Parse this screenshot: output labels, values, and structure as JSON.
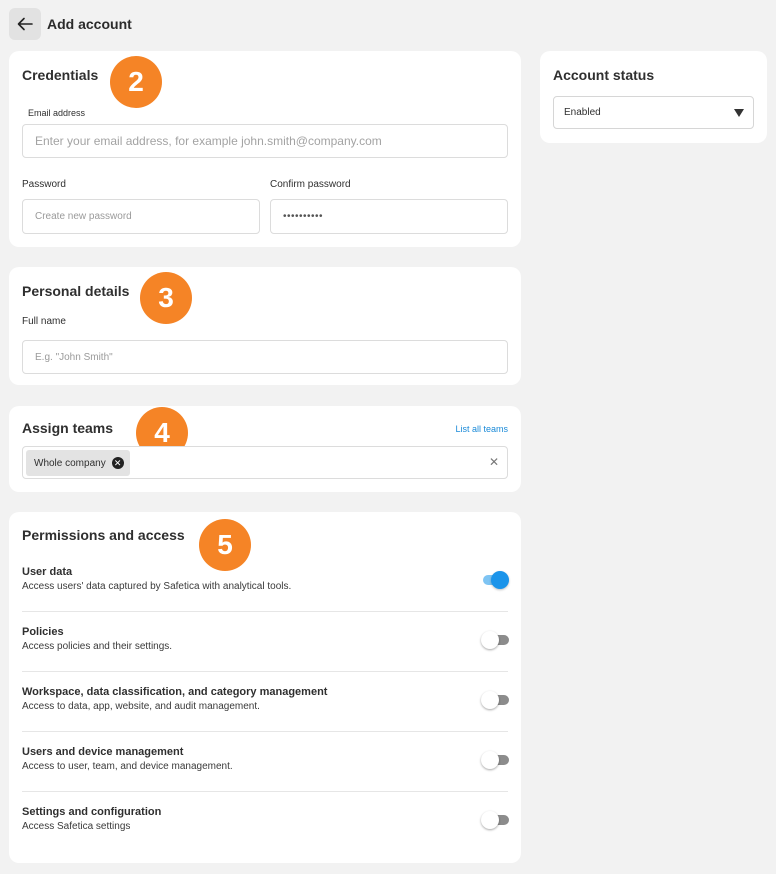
{
  "header": {
    "title": "Add account",
    "back_icon": "arrow-left-icon"
  },
  "credentials": {
    "title": "Credentials",
    "step": "2",
    "email_label": "Email address",
    "email_placeholder": "Enter your email address, for example john.smith@company.com",
    "password_label": "Password",
    "password_placeholder": "Create new password",
    "confirm_label": "Confirm password",
    "confirm_value": "••••••••••"
  },
  "personal": {
    "title": "Personal details",
    "step": "3",
    "fullname_label": "Full name",
    "fullname_placeholder": "E.g. \"John Smith\""
  },
  "teams": {
    "title": "Assign teams",
    "step": "4",
    "list_link": "List all teams",
    "chips": [
      "Whole company"
    ]
  },
  "permissions": {
    "title": "Permissions and access",
    "step": "5",
    "items": [
      {
        "title": "User data",
        "desc": "Access users' data captured by Safetica with analytical tools.",
        "enabled": true
      },
      {
        "title": "Policies",
        "desc": "Access policies and their settings.",
        "enabled": false
      },
      {
        "title": "Workspace, data classification, and category management",
        "desc": "Access to data, app, website, and audit management.",
        "enabled": false
      },
      {
        "title": "Users and device management",
        "desc": "Access to user, team, and device management.",
        "enabled": false
      },
      {
        "title": "Settings and configuration",
        "desc": "Access Safetica settings",
        "enabled": false
      }
    ]
  },
  "status": {
    "title": "Account status",
    "selected": "Enabled"
  },
  "colors": {
    "accent": "#1b94ea",
    "badge": "#f58426",
    "background": "#f2f2f2"
  }
}
